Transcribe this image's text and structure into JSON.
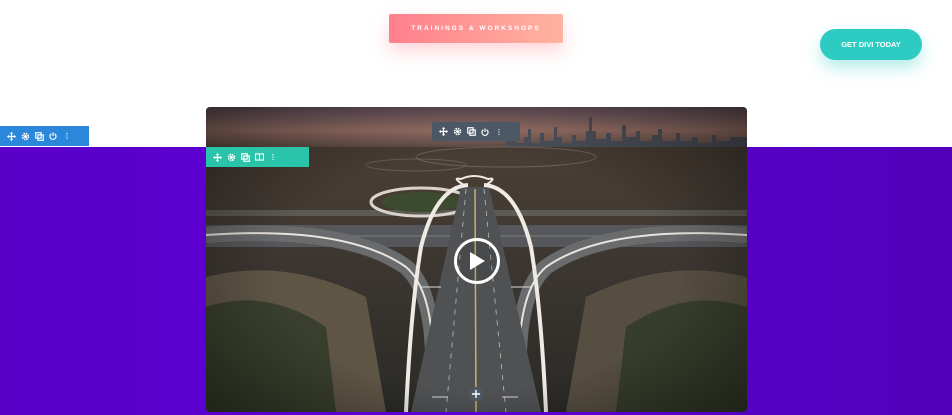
{
  "header": {
    "badge_label": "TRAININGS & WORKSHOPS",
    "cta_label": "GET DIVI TODAY"
  },
  "section_toolbar": {
    "icons": [
      "move-icon",
      "gear-icon",
      "duplicate-icon",
      "power-icon",
      "more-icon"
    ]
  },
  "row_toolbar": {
    "icons": [
      "move-icon",
      "gear-icon",
      "duplicate-icon",
      "columns-icon",
      "more-icon"
    ]
  },
  "module_toolbar": {
    "icons": [
      "move-icon",
      "gear-icon",
      "duplicate-icon",
      "power-icon",
      "more-icon"
    ]
  },
  "video": {
    "play_icon": "play-icon",
    "add_icon": "add-icon"
  },
  "colors": {
    "section_toolbar": "#2b87da",
    "row_toolbar": "#29c4a9",
    "module_toolbar": "#4c5866",
    "cta": "#2ecbc3",
    "background_band": "#5a00c9",
    "badge_start": "#ff7f8c",
    "badge_end": "#ffb3a0"
  }
}
